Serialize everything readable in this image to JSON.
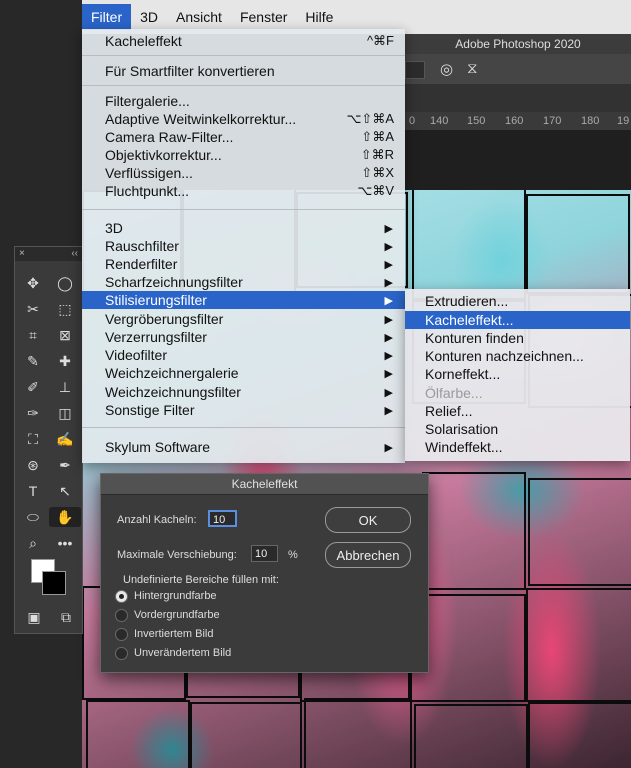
{
  "menubar": {
    "items": [
      "Filter",
      "3D",
      "Ansicht",
      "Fenster",
      "Hilfe"
    ],
    "active": "Filter"
  },
  "window": {
    "title": "Adobe Photoshop 2020",
    "ruler_ticks": [
      "0",
      "140",
      "150",
      "160",
      "170",
      "180",
      "19"
    ]
  },
  "filter_menu": {
    "last_filter": {
      "label": "Kacheleffekt",
      "shortcut": "^⌘F"
    },
    "smart": "Für Smartfilter konvertieren",
    "group1": [
      {
        "label": "Filtergalerie...",
        "shortcut": ""
      },
      {
        "label": "Adaptive Weitwinkelkorrektur...",
        "shortcut": "⌥⇧⌘A"
      },
      {
        "label": "Camera Raw-Filter...",
        "shortcut": "⇧⌘A"
      },
      {
        "label": "Objektivkorrektur...",
        "shortcut": "⇧⌘R"
      },
      {
        "label": "Verflüssigen...",
        "shortcut": "⇧⌘X"
      },
      {
        "label": "Fluchtpunkt...",
        "shortcut": "⌥⌘V"
      }
    ],
    "group2": [
      {
        "label": "3D"
      },
      {
        "label": "Rauschfilter"
      },
      {
        "label": "Renderfilter"
      },
      {
        "label": "Scharfzeichnungsfilter"
      },
      {
        "label": "Stilisierungsfilter",
        "highlighted": true
      },
      {
        "label": "Vergröberungsfilter"
      },
      {
        "label": "Verzerrungsfilter"
      },
      {
        "label": "Videofilter"
      },
      {
        "label": "Weichzeichnergalerie"
      },
      {
        "label": "Weichzeichnungsfilter"
      },
      {
        "label": "Sonstige Filter"
      }
    ],
    "plugin": "Skylum Software",
    "arrow": "▶"
  },
  "submenu": {
    "items": [
      {
        "label": "Extrudieren..."
      },
      {
        "label": "Kacheleffekt...",
        "highlighted": true
      },
      {
        "label": "Konturen finden"
      },
      {
        "label": "Konturen nachzeichnen..."
      },
      {
        "label": "Korneffekt..."
      },
      {
        "label": "Ölfarbe...",
        "disabled": true
      },
      {
        "label": "Relief..."
      },
      {
        "label": "Solarisation"
      },
      {
        "label": "Windeffekt..."
      }
    ]
  },
  "dialog": {
    "title": "Kacheleffekt",
    "tiles_label": "Anzahl Kacheln:",
    "tiles_value": "10",
    "offset_label": "Maximale Verschiebung:",
    "offset_value": "10",
    "offset_unit": "%",
    "fill_label": "Undefinierte Bereiche füllen mit:",
    "options": [
      "Hintergrundfarbe",
      "Vordergrundfarbe",
      "Invertiertem Bild",
      "Unverändertem Bild"
    ],
    "selected_option": 0,
    "ok_label": "OK",
    "cancel_label": "Abbrechen"
  },
  "tools": {
    "close": "×",
    "collapse": "‹‹",
    "items": [
      "✥",
      "◯",
      "✂",
      "⬚",
      "⌗",
      "⊠",
      "✎",
      "✚",
      "✐",
      "⊥",
      "✑",
      "◫",
      "⛶",
      "✍",
      "⊛",
      "✒",
      "T",
      "↖",
      "⬭",
      "✋",
      "⌕",
      "•••",
      "▣",
      "⧉"
    ]
  }
}
